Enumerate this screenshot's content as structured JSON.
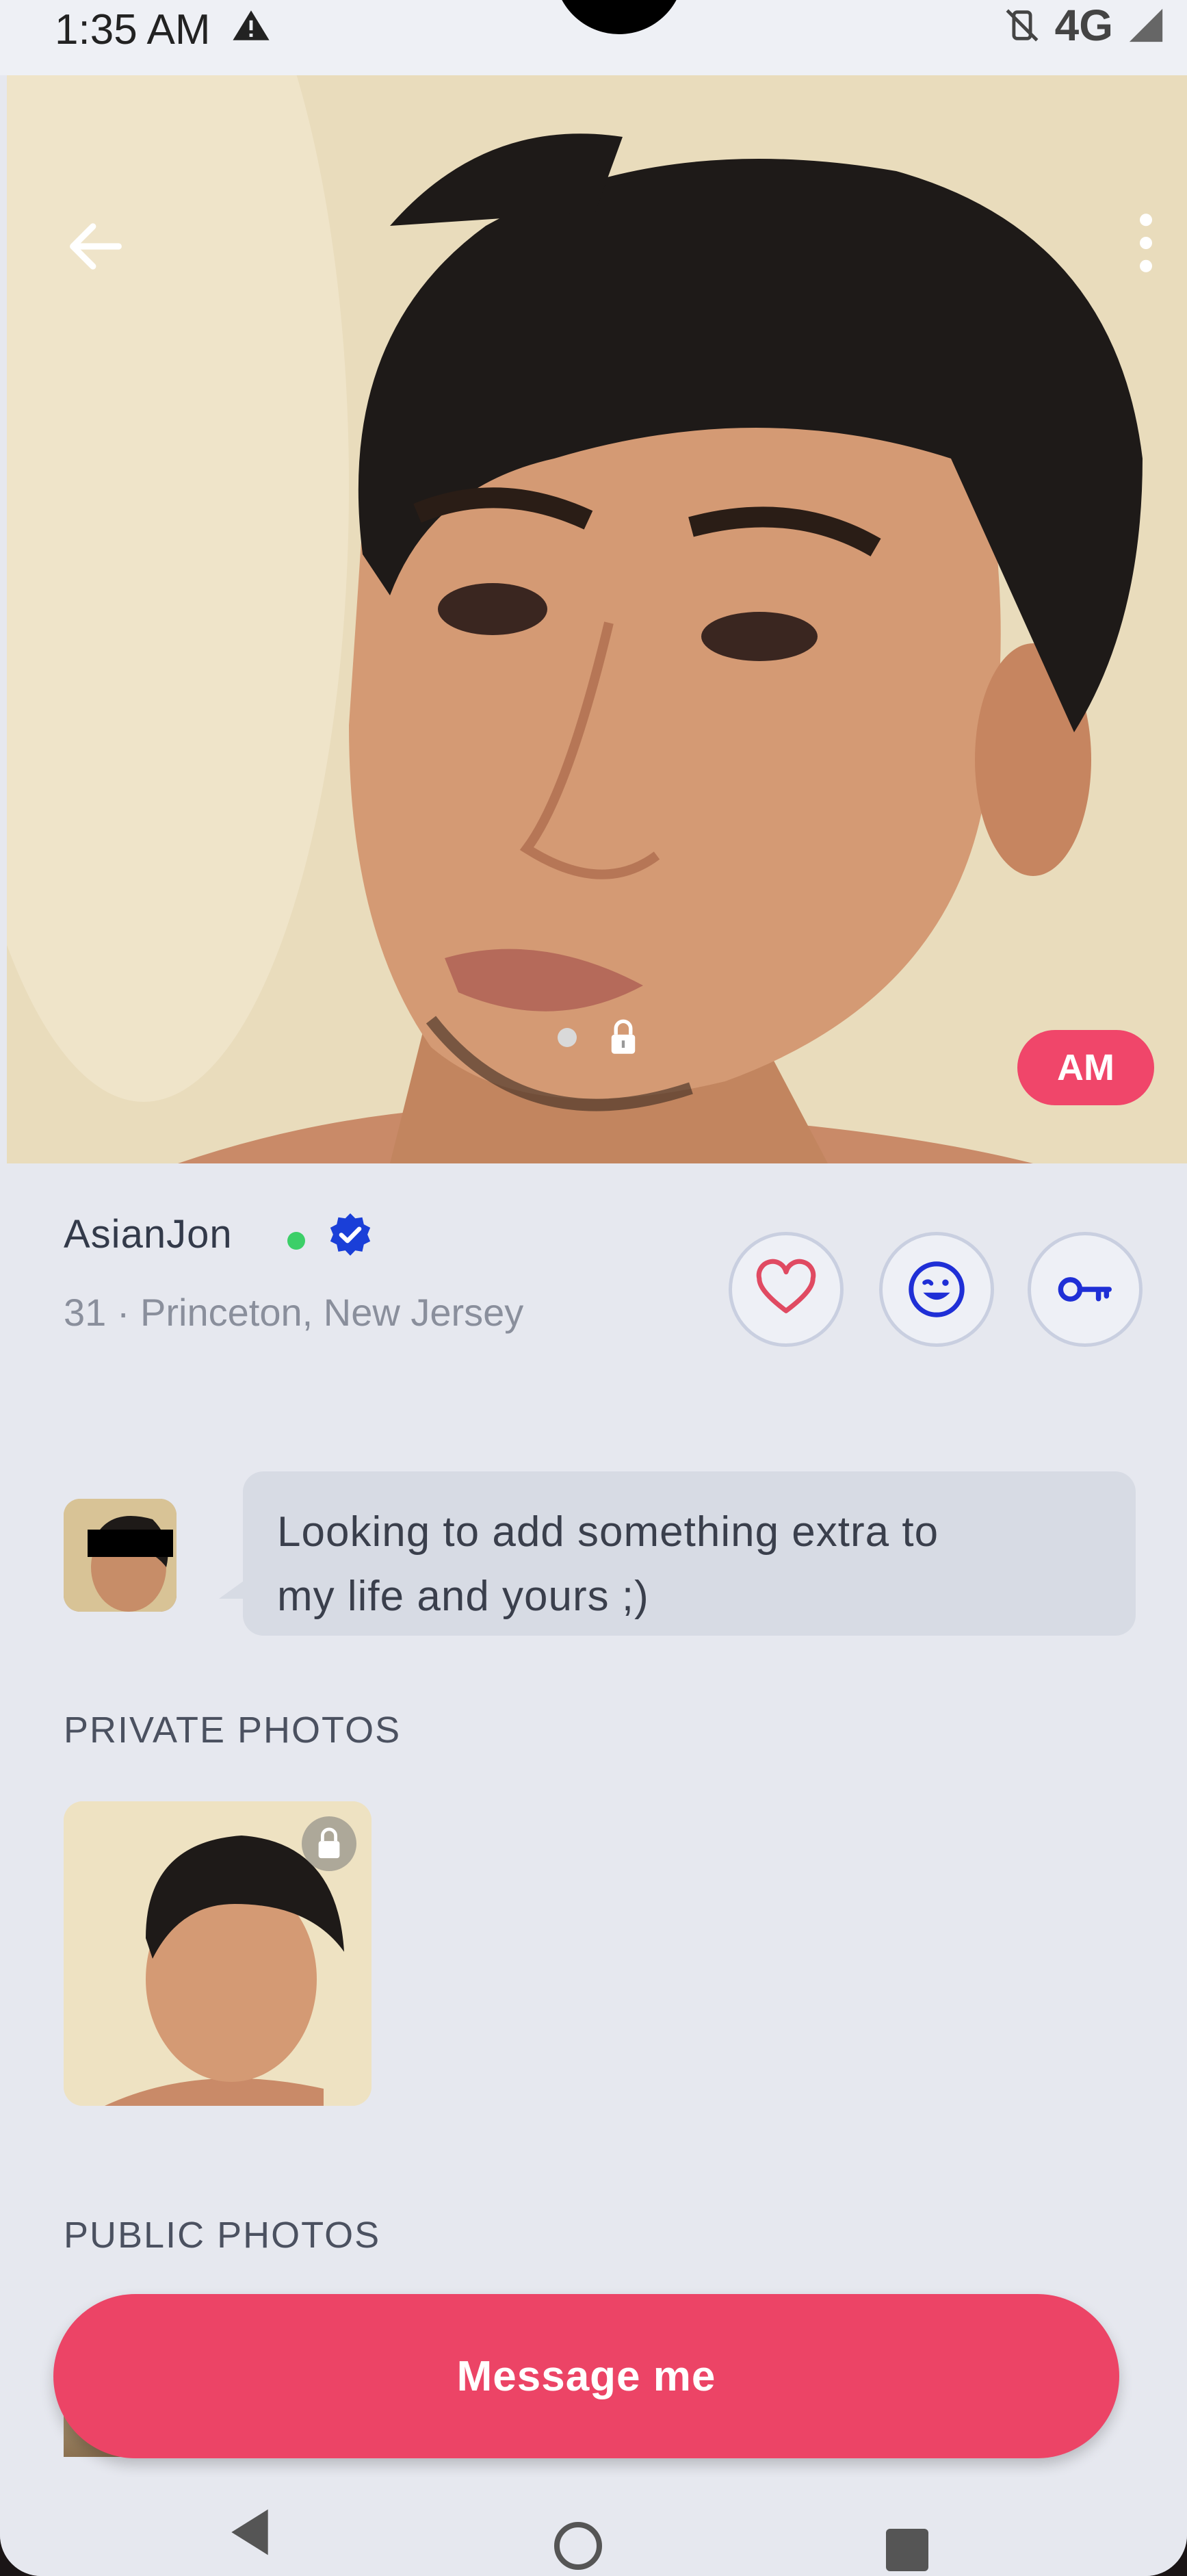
{
  "status_bar": {
    "time": "1:35 AM",
    "network": "4G"
  },
  "hero": {
    "badge": "AM"
  },
  "profile": {
    "username": "AsianJon",
    "subtitle": "31 · Princeton, New Jersey",
    "online_color": "#3ccf68",
    "verified_color": "#1a3fd8"
  },
  "actions": [
    {
      "name": "like",
      "icon": "heart-icon",
      "color": "#e04a62"
    },
    {
      "name": "wink",
      "icon": "wink-face-icon",
      "color": "#1f2fd6"
    },
    {
      "name": "key",
      "icon": "key-icon",
      "color": "#1f2fd6"
    }
  ],
  "bio": {
    "text_line1": "Looking to add something extra to",
    "text_line2": "my life and yours ;)"
  },
  "sections": {
    "private_photos": "PRIVATE PHOTOS",
    "public_photos": "PUBLIC PHOTOS"
  },
  "cta": {
    "label": "Message me",
    "color": "#ec4466"
  }
}
